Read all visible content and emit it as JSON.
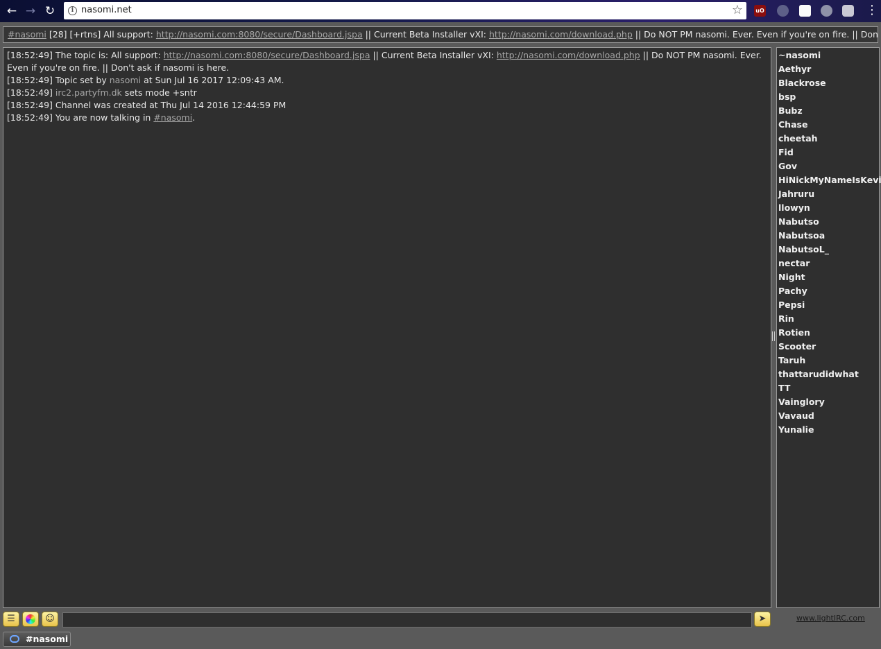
{
  "browser": {
    "url": "nasomi.net",
    "extensions": [
      "ublock-origin-icon",
      "extension-icon",
      "blank-extension-icon",
      "extension-icon",
      "extension-icon"
    ],
    "ublock_label": "uO"
  },
  "topic_bar": {
    "channel": "#nasomi",
    "user_count": "[28]",
    "modes": "[+rtns]",
    "prefix": "All support:",
    "link1": "http://nasomi.com:8080/secure/Dashboard.jspa",
    "mid": "|| Current Beta Installer vXI:",
    "link2": "http://nasomi.com/download.php",
    "suffix": "||  Do NOT PM nasomi. Ever. Even if you're on fire. || Don't"
  },
  "chat": {
    "messages": [
      {
        "time": "[18:52:49]",
        "pre": "The topic is: All support:",
        "link1": "http://nasomi.com:8080/secure/Dashboard.jspa",
        "mid": "|| Current Beta Installer vXI:",
        "link2": "http://nasomi.com/download.php",
        "post": "||  Do NOT PM nasomi. Ever. Even if you're on fire. || Don't ask if nasomi is here."
      },
      {
        "time": "[18:52:49]",
        "pre": "Topic set by",
        "nick": "nasomi",
        "post": "at Sun Jul 16 2017 12:09:43 AM."
      },
      {
        "time": "[18:52:49]",
        "nick": "irc2.partyfm.dk",
        "post": "sets mode +sntr"
      },
      {
        "time": "[18:52:49]",
        "text": "Channel was created at Thu Jul 14 2016 12:44:59 PM"
      },
      {
        "time": "[18:52:49]",
        "pre": "You are now talking in",
        "channel": "#nasomi",
        "post": "."
      }
    ]
  },
  "userlist": [
    "~nasomi",
    "Aethyr",
    "Blackrose",
    "bsp",
    "Bubz",
    "Chase",
    "cheetah",
    "Fid",
    "Gov",
    "HiNickMyNameIsKevin",
    "Jahruru",
    "llowyn",
    "Nabutso",
    "Nabutsoa",
    "NabutsoL_",
    "nectar",
    "Night",
    "Pachy",
    "Pepsi",
    "Rin",
    "Rotien",
    "Scooter",
    "Taruh",
    "thattarudidwhat",
    "TT",
    "Vainglory",
    "Vavaud",
    "Yunalie"
  ],
  "input": {
    "value": "",
    "placeholder": ""
  },
  "footer": {
    "link": "www.lightIRC.com"
  },
  "tabs": [
    {
      "label": "#nasomi"
    }
  ]
}
